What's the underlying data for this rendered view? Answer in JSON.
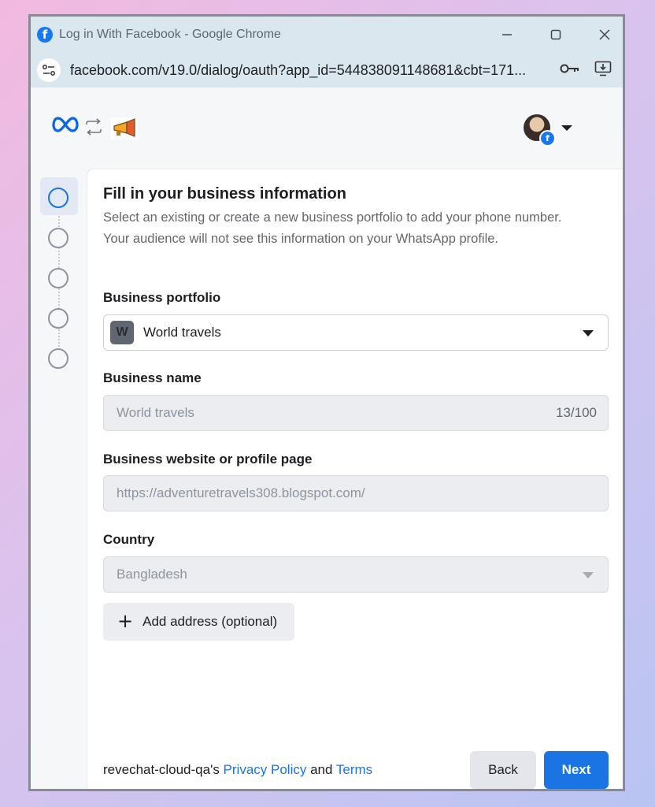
{
  "window": {
    "title": "Log in With Facebook - Google Chrome",
    "url": "facebook.com/v19.0/dialog/oauth?app_id=544838091148681&cbt=171..."
  },
  "icons": {
    "browser_app": "facebook-icon",
    "minimize": "minimize-icon",
    "maximize": "maximize-icon",
    "close": "close-icon",
    "site_info": "site-settings-icon",
    "password": "key-icon",
    "install": "install-app-icon",
    "brand": "meta-logo-icon",
    "connect": "swap-arrows-icon",
    "app": "megaphone-app-icon",
    "account": "avatar",
    "account_menu": "chevron-down-icon",
    "plus": "plus-icon"
  },
  "steps": [
    {
      "state": "current"
    },
    {
      "state": "pending"
    },
    {
      "state": "pending"
    },
    {
      "state": "pending"
    },
    {
      "state": "pending"
    }
  ],
  "form": {
    "title": "Fill in your business information",
    "description": "Select an existing or create a new business portfolio to add your phone number. Your audience will not see this information on your WhatsApp profile.",
    "portfolio": {
      "label": "Business portfolio",
      "badge": "W",
      "value": "World travels"
    },
    "business_name": {
      "label": "Business name",
      "value": "World travels",
      "counter": "13/100"
    },
    "website": {
      "label": "Business website or profile page",
      "value": "https://adventuretravels308.blogspot.com/"
    },
    "country": {
      "label": "Country",
      "value": "Bangladesh"
    },
    "add_address_label": "Add address (optional)"
  },
  "footer": {
    "prefix": "revechat-cloud-qa's ",
    "privacy_label": "Privacy Policy",
    "and_text": " and ",
    "terms_label": "Terms",
    "back_label": "Back",
    "next_label": "Next"
  },
  "colors": {
    "accent": "#1b74e4",
    "facebook_blue": "#1877f2",
    "titlebar": "#dbe7ee"
  }
}
